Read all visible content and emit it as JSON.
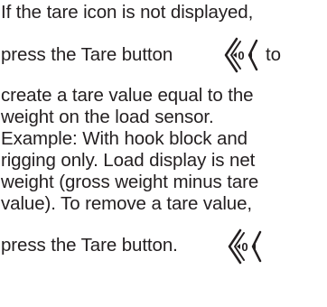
{
  "text": {
    "line1": "If the tare icon is not displayed,",
    "line2a": "press the Tare button",
    "line2b": "to",
    "line3": "create a tare value equal to the",
    "line4": "weight on the load sensor.",
    "line5": "Example: With hook block and",
    "line6": "rigging only. Load display is net",
    "line7": "weight (gross weight minus tare",
    "line8": "value). To remove a tare value,",
    "line9": "press the Tare button."
  },
  "icons": {
    "tare_button": "tare-button-icon"
  },
  "colors": {
    "text": "#231f20",
    "icon_stroke": "#231f20",
    "background": "#ffffff"
  }
}
